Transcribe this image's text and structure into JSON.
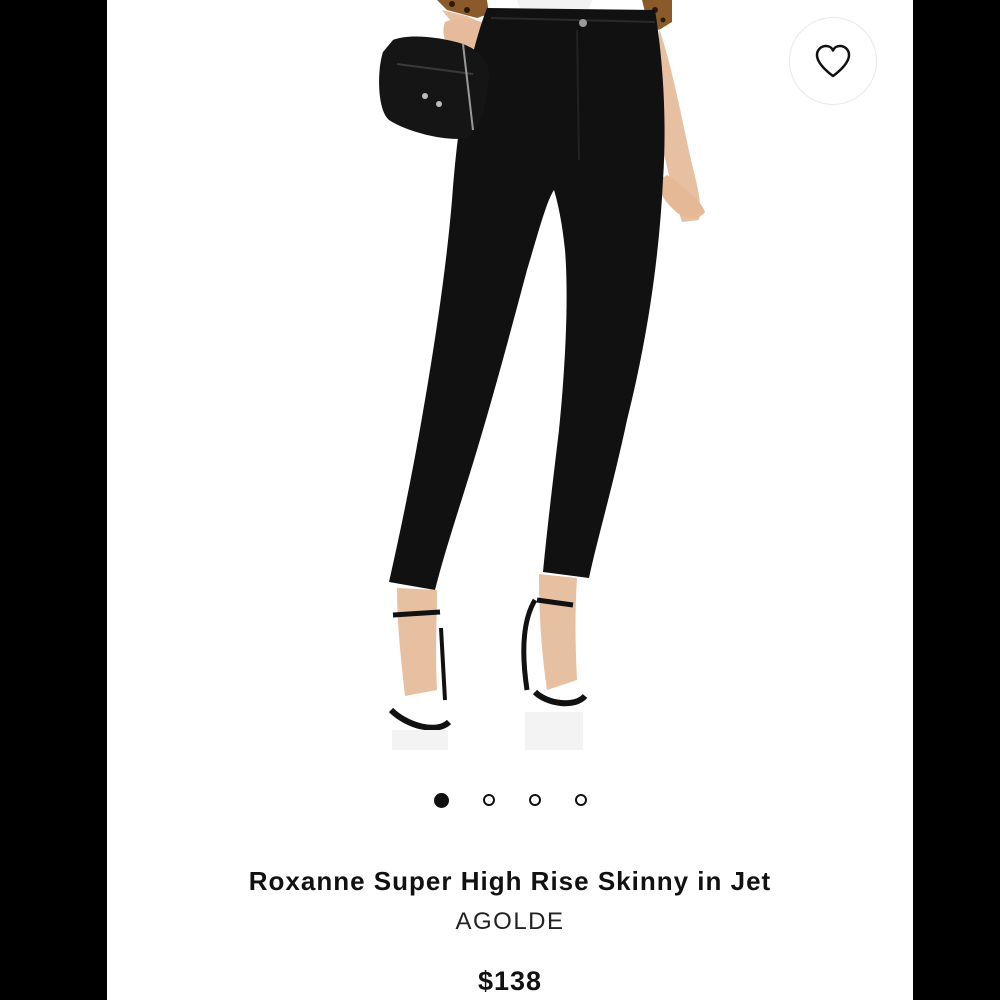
{
  "product": {
    "title": "Roxanne Super High Rise Skinny in Jet",
    "brand": "AGOLDE",
    "price": "$138"
  },
  "gallery": {
    "image_count": 4,
    "active_index": 0,
    "image_description_icon": "model-wearing-black-skinny-jeans"
  },
  "favorite": {
    "icon": "heart-outline-icon"
  },
  "colors": {
    "background_sides": "#000000",
    "card": "#ffffff",
    "jeans": "#111111",
    "text": "#111111"
  }
}
